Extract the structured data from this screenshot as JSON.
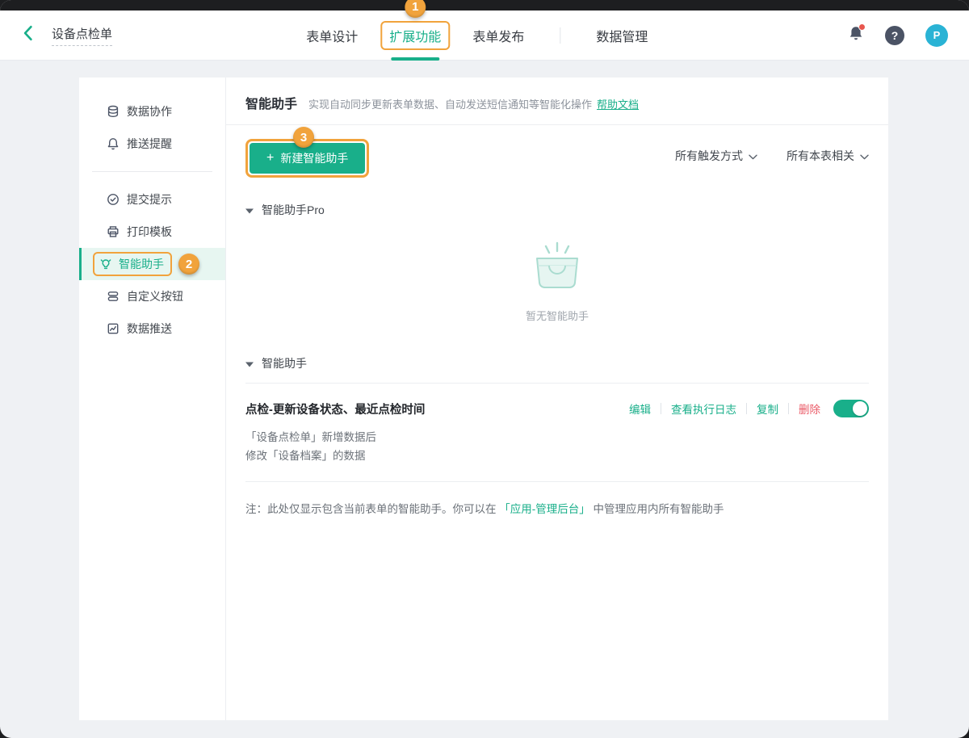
{
  "colors": {
    "accent": "#19af8a",
    "annotation_orange": "#f1a33c",
    "danger": "#ea5a67",
    "avatar_cyan": "#2ab3d5",
    "icon_slate": "#4b5365"
  },
  "annotations": {
    "step1": "1",
    "step2": "2",
    "step3": "3"
  },
  "topbar": {
    "form_title": "设备点检单",
    "tabs": [
      {
        "label": "表单设计"
      },
      {
        "label": "扩展功能",
        "active": true
      },
      {
        "label": "表单发布"
      },
      {
        "label": "数据管理"
      }
    ],
    "help_glyph": "?",
    "avatar_initial": "P"
  },
  "sidebar": {
    "items": [
      {
        "label": "数据协作",
        "icon": "database-icon"
      },
      {
        "label": "推送提醒",
        "icon": "bell-icon"
      },
      {
        "label": "提交提示",
        "icon": "check-circle-icon"
      },
      {
        "label": "打印模板",
        "icon": "printer-icon"
      },
      {
        "label": "智能助手",
        "icon": "bulb-icon",
        "active": true
      },
      {
        "label": "自定义按钮",
        "icon": "buttons-icon"
      },
      {
        "label": "数据推送",
        "icon": "chart-icon"
      }
    ]
  },
  "main": {
    "header": {
      "title": "智能助手",
      "subtitle": "实现自动同步更新表单数据、自动发送短信通知等智能化操作",
      "help_link": "帮助文档"
    },
    "toolbar": {
      "plus": "+",
      "new_button": "新建智能助手",
      "filters": [
        {
          "label": "所有触发方式"
        },
        {
          "label": "所有本表相关"
        }
      ]
    },
    "pro_section": {
      "label": "智能助手Pro",
      "empty_text": "暂无智能助手"
    },
    "list_section": {
      "label": "智能助手",
      "item": {
        "title": "点检-更新设备状态、最近点检时间",
        "actions": [
          {
            "label": "编辑"
          },
          {
            "label": "查看执行日志"
          },
          {
            "label": "复制"
          },
          {
            "label": "删除",
            "danger": true
          }
        ],
        "toggle_on": true,
        "desc_lines": [
          "「设备点检单」新增数据后",
          "修改「设备档案」的数据"
        ]
      }
    },
    "note": {
      "part1": "注：此处仅显示包含当前表单的智能助手。你可以在",
      "link": "「应用-管理后台」",
      "part2": "中管理应用内所有智能助手"
    }
  }
}
